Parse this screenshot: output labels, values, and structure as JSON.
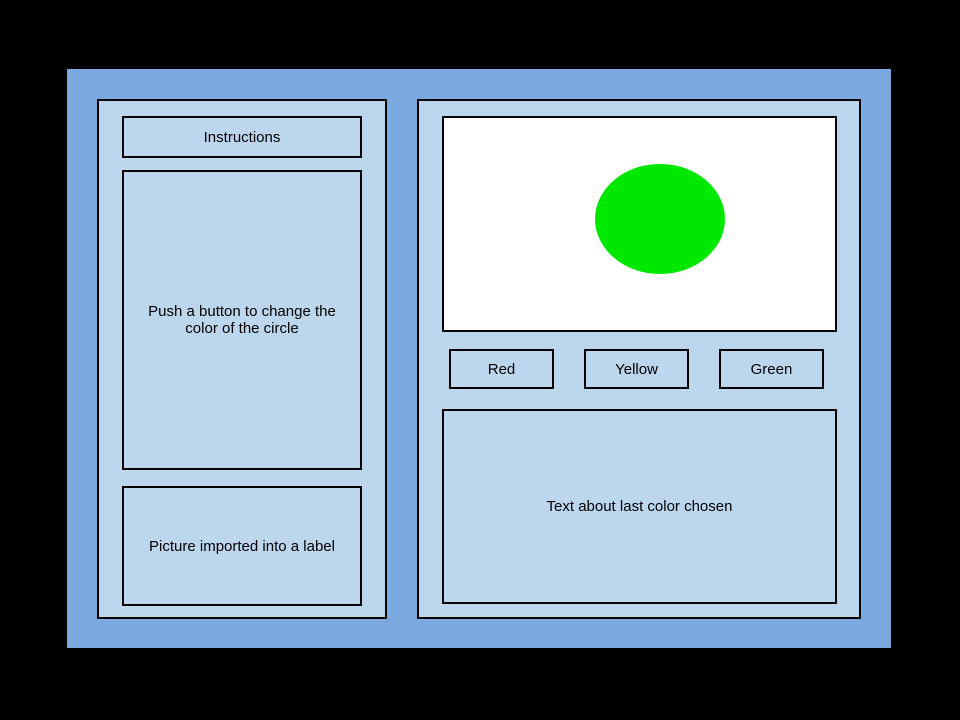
{
  "left": {
    "heading": "Instructions",
    "body": "Push a button to change the color of the circle",
    "picture_label": "Picture imported into a label"
  },
  "right": {
    "circle_color": "#00e800",
    "buttons": {
      "red": "Red",
      "yellow": "Yellow",
      "green": "Green"
    },
    "status_text": "Text about last color chosen"
  }
}
